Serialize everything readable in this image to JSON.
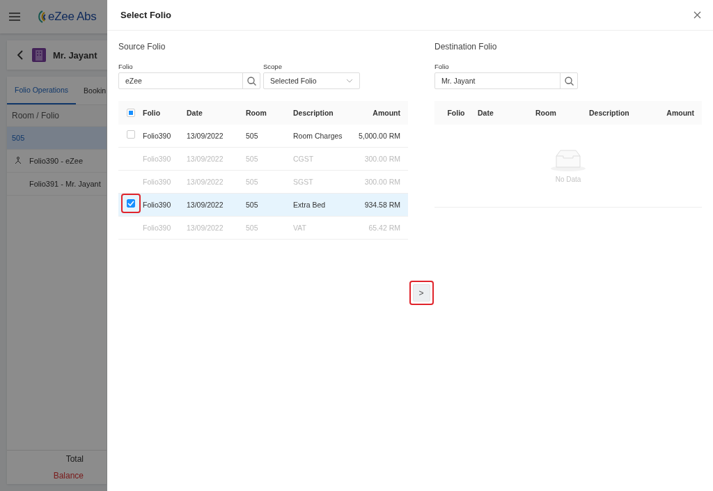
{
  "app": {
    "logo_text": "eZee Abs",
    "guest_name": "Mr. Jayant",
    "tabs": [
      {
        "label": "Folio Operations",
        "selected": true
      },
      {
        "label": "Bookin",
        "selected": false
      }
    ],
    "folio_table": {
      "header": "Room / Folio",
      "rows": [
        {
          "label": "505",
          "kind": "room",
          "selected": true
        },
        {
          "label": "Folio390 - eZee",
          "kind": "master",
          "selected": false
        },
        {
          "label": "Folio391 - Mr. Jayant",
          "kind": "folio",
          "selected": false
        }
      ]
    },
    "footer": {
      "total_label": "Total",
      "balance_label": "Balance"
    }
  },
  "dialog": {
    "title": "Select Folio",
    "source": {
      "heading": "Source Folio",
      "folio_label": "Folio",
      "folio_value": "eZee",
      "scope_label": "Scope",
      "scope_value": "Selected Folio",
      "header_checkbox": {
        "indeterminate": true
      },
      "columns": [
        "Folio",
        "Date",
        "Room",
        "Description",
        "Amount"
      ],
      "rows": [
        {
          "cells": [
            "Folio390",
            "13/09/2022",
            "505",
            "Room Charges",
            "5,000.00 RM"
          ],
          "disabled": false,
          "checked": false,
          "selected": false,
          "highlighted": false
        },
        {
          "cells": [
            "Folio390",
            "13/09/2022",
            "505",
            "CGST",
            "300.00 RM"
          ],
          "disabled": true,
          "selected": false
        },
        {
          "cells": [
            "Folio390",
            "13/09/2022",
            "505",
            "SGST",
            "300.00 RM"
          ],
          "disabled": true,
          "selected": false
        },
        {
          "cells": [
            "Folio390",
            "13/09/2022",
            "505",
            "Extra Bed",
            "934.58 RM"
          ],
          "disabled": false,
          "checked": true,
          "selected": true,
          "highlighted": true
        },
        {
          "cells": [
            "Folio390",
            "13/09/2022",
            "505",
            "VAT",
            "65.42 RM"
          ],
          "disabled": true,
          "selected": false
        }
      ]
    },
    "move_button": {
      "label": ">",
      "highlighted": true
    },
    "destination": {
      "heading": "Destination Folio",
      "folio_label": "Folio",
      "folio_value": "Mr. Jayant",
      "columns": [
        "Folio",
        "Date",
        "Room",
        "Description",
        "Amount"
      ],
      "empty_text": "No Data"
    }
  }
}
